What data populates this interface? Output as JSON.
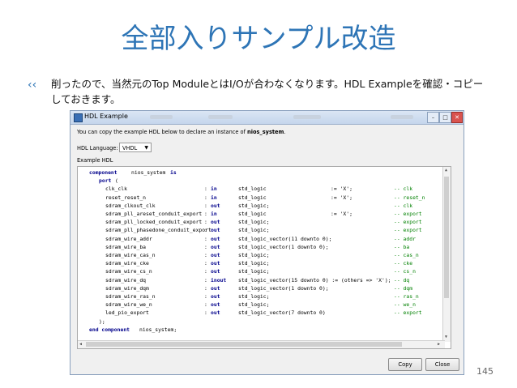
{
  "slide": {
    "title": "全部入りサンプル改造",
    "bullet_icon": "arrow-bullet-icon",
    "bullet_text": "削ったので、当然元のTop ModuleとはI/Oが合わなくなります。HDL Exampleを確認・コピーしておきます。",
    "page_number": "145"
  },
  "dialog": {
    "title": "HDL Example",
    "intro_prefix": "You can copy the example HDL below to declare an instance of ",
    "intro_name": "nios_system",
    "intro_suffix": ".",
    "language_label": "HDL Language:",
    "language_value": "VHDL",
    "example_label": "Example HDL",
    "copy_label": "Copy",
    "close_label": "Close",
    "code": {
      "header": "component nios_system is",
      "port_open": "port (",
      "ports": [
        {
          "name": "clk_clk",
          "dir": "in",
          "type": "std_logic",
          "default": ":= 'X';",
          "comment": "-- clk"
        },
        {
          "name": "reset_reset_n",
          "dir": "in",
          "type": "std_logic",
          "default": ":= 'X';",
          "comment": "-- reset_n"
        },
        {
          "name": "sdram_clkout_clk",
          "dir": "out",
          "type": "std_logic;",
          "default": "",
          "comment": "-- clk"
        },
        {
          "name": "sdram_pll_areset_conduit_export",
          "dir": "in",
          "type": "std_logic",
          "default": ":= 'X';",
          "comment": "-- export"
        },
        {
          "name": "sdram_pll_locked_conduit_export",
          "dir": "out",
          "type": "std_logic;",
          "default": "",
          "comment": "-- export"
        },
        {
          "name": "sdram_pll_phasedone_conduit_export",
          "dir": "out",
          "type": "std_logic;",
          "default": "",
          "comment": "-- export"
        },
        {
          "name": "sdram_wire_addr",
          "dir": "out",
          "type": "std_logic_vector(11 downto 0);",
          "default": "",
          "comment": "-- addr"
        },
        {
          "name": "sdram_wire_ba",
          "dir": "out",
          "type": "std_logic_vector(1 downto 0);",
          "default": "",
          "comment": "-- ba"
        },
        {
          "name": "sdram_wire_cas_n",
          "dir": "out",
          "type": "std_logic;",
          "default": "",
          "comment": "-- cas_n"
        },
        {
          "name": "sdram_wire_cke",
          "dir": "out",
          "type": "std_logic;",
          "default": "",
          "comment": "-- cke"
        },
        {
          "name": "sdram_wire_cs_n",
          "dir": "out",
          "type": "std_logic;",
          "default": "",
          "comment": "-- cs_n"
        },
        {
          "name": "sdram_wire_dq",
          "dir": "inout",
          "type": "std_logic_vector(15 downto 0) := (others => 'X');",
          "default": "",
          "comment": "-- dq"
        },
        {
          "name": "sdram_wire_dqm",
          "dir": "out",
          "type": "std_logic_vector(1 downto 0);",
          "default": "",
          "comment": "-- dqm"
        },
        {
          "name": "sdram_wire_ras_n",
          "dir": "out",
          "type": "std_logic;",
          "default": "",
          "comment": "-- ras_n"
        },
        {
          "name": "sdram_wire_we_n",
          "dir": "out",
          "type": "std_logic;",
          "default": "",
          "comment": "-- we_n"
        },
        {
          "name": "led_pio_export",
          "dir": "out",
          "type": "std_logic_vector(7 downto 0)",
          "default": "",
          "comment": "-- export"
        }
      ],
      "port_close": ");",
      "footer": "end component nios_system;"
    }
  },
  "colors": {
    "title": "#2e75b6",
    "keyword": "#00008b",
    "comment": "#008000"
  }
}
